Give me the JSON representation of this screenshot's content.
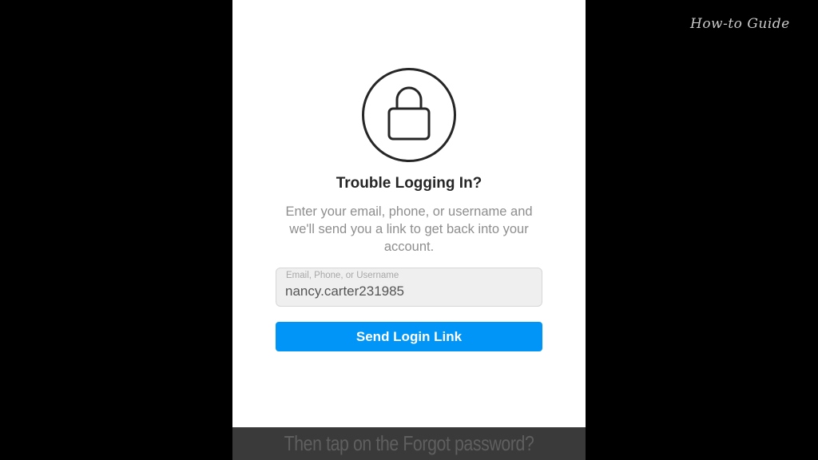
{
  "watermark": {
    "text": "How-to Guide"
  },
  "screen": {
    "icon": "lock-icon",
    "title": "Trouble Logging In?",
    "description": "Enter your email, phone, or username and we'll send you a link to get back into your account.",
    "input": {
      "label": "Email, Phone, or Username",
      "value": "nancy.carter231985"
    },
    "send_button_label": "Send Login Link"
  },
  "caption": {
    "text": "Then tap on the Forgot password?"
  },
  "colors": {
    "button": "#0095f6",
    "background": "#000000",
    "panel": "#ffffff"
  }
}
